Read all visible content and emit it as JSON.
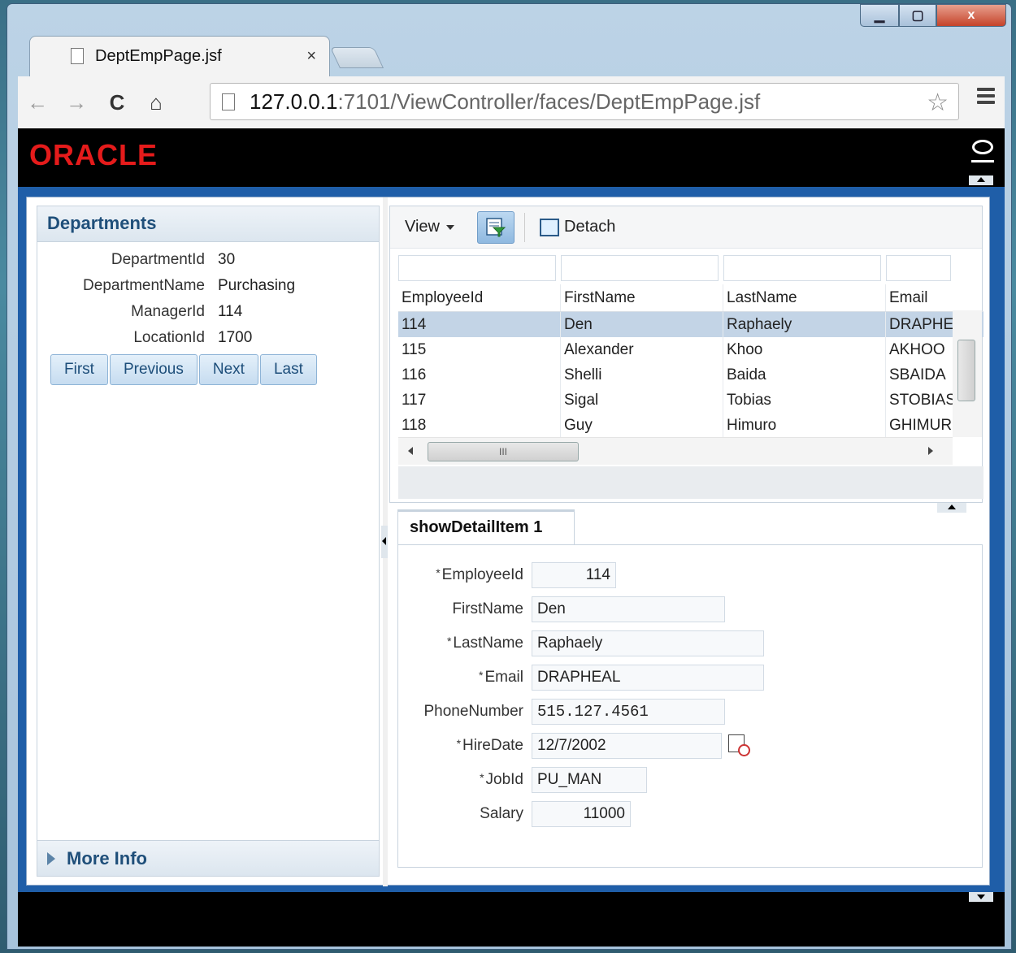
{
  "browser": {
    "tab_title": "DeptEmpPage.jsf",
    "tab_close": "×",
    "url_host": "127.0.0.1",
    "url_rest": ":7101/ViewController/faces/DeptEmpPage.jsf",
    "nav": {
      "back": "←",
      "forward": "→",
      "reload": "C",
      "home": "⌂"
    },
    "star": "☆"
  },
  "window_controls": {
    "close": "x"
  },
  "brand": {
    "logo": "ORACLE"
  },
  "departments": {
    "title": "Departments",
    "fields": [
      {
        "label": "DepartmentId",
        "value": "30"
      },
      {
        "label": "DepartmentName",
        "value": "Purchasing"
      },
      {
        "label": "ManagerId",
        "value": "114"
      },
      {
        "label": "LocationId",
        "value": "1700"
      }
    ],
    "buttons": [
      "First",
      "Previous",
      "Next",
      "Last"
    ],
    "more_info": "More Info"
  },
  "employees_table": {
    "view_label": "View",
    "detach_label": "Detach",
    "columns": [
      "EmployeeId",
      "FirstName",
      "LastName",
      "Email"
    ],
    "rows": [
      [
        "114",
        "Den",
        "Raphaely",
        "DRAPHE/"
      ],
      [
        "115",
        "Alexander",
        "Khoo",
        "AKHOO"
      ],
      [
        "116",
        "Shelli",
        "Baida",
        "SBAIDA"
      ],
      [
        "117",
        "Sigal",
        "Tobias",
        "STOBIAS"
      ],
      [
        "118",
        "Guy",
        "Himuro",
        "GHIMUR("
      ]
    ],
    "selected_row": 0,
    "hscroll_grip": "III"
  },
  "detail": {
    "tab_label": "showDetailItem 1",
    "fields": [
      {
        "label": "EmployeeId",
        "value": "114",
        "required": true
      },
      {
        "label": "FirstName",
        "value": "Den",
        "required": false
      },
      {
        "label": "LastName",
        "value": "Raphaely",
        "required": true
      },
      {
        "label": "Email",
        "value": "DRAPHEAL",
        "required": true
      },
      {
        "label": "PhoneNumber",
        "value": "515.127.4561",
        "required": false
      },
      {
        "label": "HireDate",
        "value": "12/7/2002",
        "required": true
      },
      {
        "label": "JobId",
        "value": "PU_MAN",
        "required": true
      },
      {
        "label": "Salary",
        "value": "11000",
        "required": false
      }
    ],
    "required_mark": "*"
  }
}
